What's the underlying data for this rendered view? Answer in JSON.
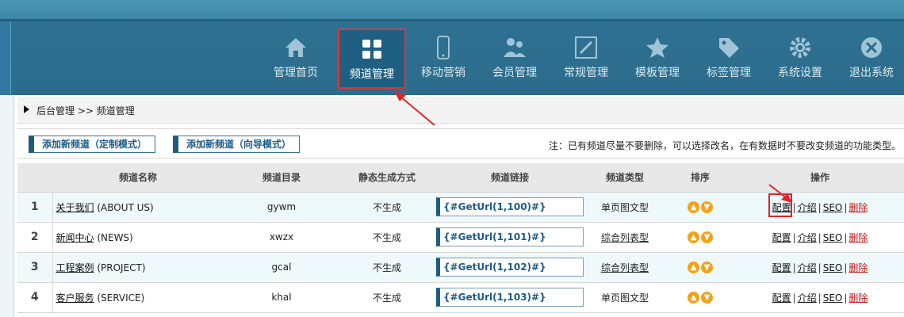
{
  "nav": {
    "items": [
      {
        "label": "管理首页",
        "icon": "home-icon"
      },
      {
        "label": "频道管理",
        "icon": "grid-icon",
        "active": true
      },
      {
        "label": "移动营销",
        "icon": "phone-icon"
      },
      {
        "label": "会员管理",
        "icon": "users-icon"
      },
      {
        "label": "常规管理",
        "icon": "edit-icon"
      },
      {
        "label": "模板管理",
        "icon": "star-icon"
      },
      {
        "label": "标签管理",
        "icon": "tag-icon"
      },
      {
        "label": "系统设置",
        "icon": "gear-icon"
      },
      {
        "label": "退出系统",
        "icon": "close-icon"
      }
    ]
  },
  "breadcrumb": "后台管理 >> 频道管理",
  "toolbar": {
    "add_custom": "添加新频道（定制模式）",
    "add_wizard": "添加新频道（向导模式）",
    "note": "注：已有频道尽量不要删除，可以选择改名，在有数据时不要改变频道的功能类型。"
  },
  "table": {
    "headers": [
      "",
      "频道名称",
      "频道目录",
      "静态生成方式",
      "频道链接",
      "频道类型",
      "排序",
      "操作"
    ],
    "rows": [
      {
        "num": "1",
        "name_cn": "关于我们",
        "name_en": " (ABOUT US)",
        "dir": "gywm",
        "static": "不生成",
        "link": "{#GetUrl(1,100)#}",
        "type": "单页图文型",
        "type_link": false
      },
      {
        "num": "2",
        "name_cn": "新闻中心",
        "name_en": " (NEWS)",
        "dir": "xwzx",
        "static": "不生成",
        "link": "{#GetUrl(1,101)#}",
        "type": "综合列表型",
        "type_link": true
      },
      {
        "num": "3",
        "name_cn": "工程案例",
        "name_en": " (PROJECT)",
        "dir": "gcal",
        "static": "不生成",
        "link": "{#GetUrl(1,102)#}",
        "type": "综合列表型",
        "type_link": true
      },
      {
        "num": "4",
        "name_cn": "客户服务",
        "name_en": " (SERVICE)",
        "dir": "khal",
        "static": "不生成",
        "link": "{#GetUrl(1,103)#}",
        "type": "单页图文型",
        "type_link": false
      }
    ],
    "ops": {
      "config": "配置",
      "intro": "介绍",
      "seo": "SEO",
      "delete": "删除",
      "sep": "|"
    }
  },
  "colors": {
    "accent": "#2c6c8c",
    "highlight": "#e23535",
    "delete": "#c31a1a",
    "orb": "#f4a21a"
  }
}
